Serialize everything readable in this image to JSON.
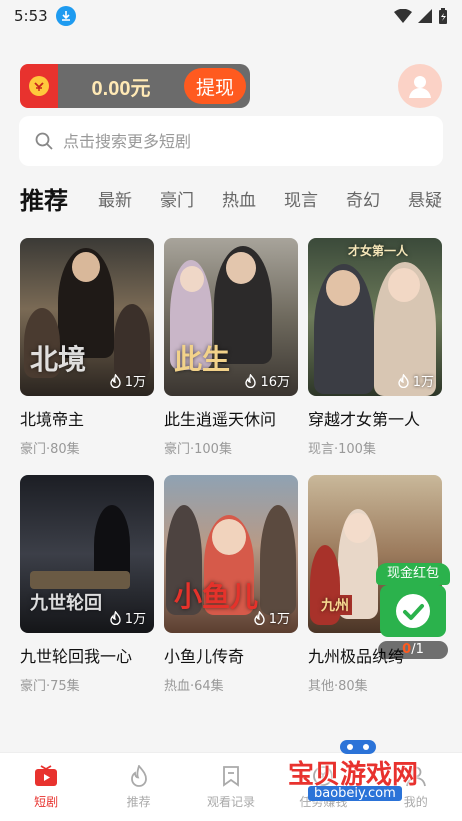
{
  "status": {
    "time": "5:53"
  },
  "wallet": {
    "amount": "0.00元",
    "withdraw_label": "提现"
  },
  "search": {
    "placeholder": "点击搜索更多短剧"
  },
  "tabs": [
    {
      "label": "推荐",
      "active": true
    },
    {
      "label": "最新"
    },
    {
      "label": "豪门"
    },
    {
      "label": "热血"
    },
    {
      "label": "现言"
    },
    {
      "label": "奇幻"
    },
    {
      "label": "悬疑"
    }
  ],
  "dramas": [
    {
      "title": "北境帝主",
      "meta": "豪门·80集",
      "views": "1万",
      "poster_text": "北境"
    },
    {
      "title": "此生逍遥天休问",
      "meta": "豪门·100集",
      "views": "16万",
      "poster_text": "此生"
    },
    {
      "title": "穿越才女第一人",
      "meta": "现言·100集",
      "views": "1万",
      "poster_text": "才女第一人"
    },
    {
      "title": "九世轮回我一心",
      "meta": "豪门·75集",
      "views": "1万",
      "poster_text": "九世轮回"
    },
    {
      "title": "小鱼儿传奇",
      "meta": "热血·64集",
      "views": "1万",
      "poster_text": "小鱼儿"
    },
    {
      "title": "九州极品纨绔",
      "meta": "其他·80集",
      "views": "1万",
      "poster_text": "九州"
    }
  ],
  "float_packet": {
    "label": "现金红包",
    "progress_current": "0",
    "progress_total": "/1"
  },
  "nav": [
    {
      "label": "短剧",
      "active": true
    },
    {
      "label": "推荐"
    },
    {
      "label": "观看记录"
    },
    {
      "label": "任务赚钱"
    },
    {
      "label": "我的"
    }
  ],
  "watermark": {
    "text": "宝贝游戏网",
    "url": "baobeiy.com"
  },
  "colors": {
    "accent": "#e8322e",
    "withdraw": "#ff5a1f",
    "packet": "#2bb24c"
  }
}
